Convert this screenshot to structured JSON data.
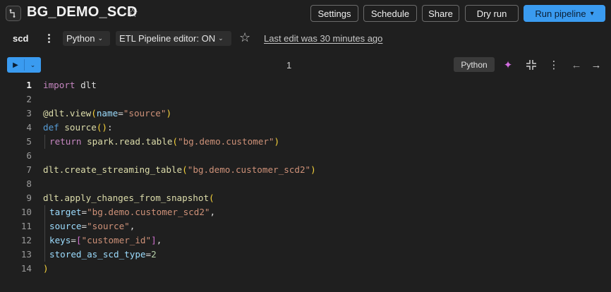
{
  "header": {
    "title": "BG_DEMO_SCD",
    "buttons": {
      "settings": "Settings",
      "schedule": "Schedule",
      "share": "Share",
      "dry_run": "Dry run",
      "run_pipeline": "Run pipeline"
    }
  },
  "toolbar": {
    "notebook_name": "scd",
    "language": "Python",
    "editor_mode": "ETL Pipeline editor: ON",
    "last_edit": "Last edit was 30 minutes ago"
  },
  "cell": {
    "number": "1",
    "language_badge": "Python"
  },
  "code": {
    "active_line": 1,
    "lines": [
      {
        "n": "1"
      },
      {
        "n": "2"
      },
      {
        "n": "3"
      },
      {
        "n": "4"
      },
      {
        "n": "5"
      },
      {
        "n": "6"
      },
      {
        "n": "7"
      },
      {
        "n": "8"
      },
      {
        "n": "9"
      },
      {
        "n": "10"
      },
      {
        "n": "11"
      },
      {
        "n": "12"
      },
      {
        "n": "13"
      },
      {
        "n": "14"
      }
    ],
    "tokens": {
      "l1_import": "import",
      "l1_mod": " dlt",
      "l3_deco": "@dlt.view",
      "l3_open": "(",
      "l3_arg": "name",
      "l3_eq": "=",
      "l3_str": "\"source\"",
      "l3_close": ")",
      "l4_def": "def",
      "l4_name": " source",
      "l4_parens": "()",
      "l4_colon": ":",
      "l5_return": "return",
      "l5_call": " spark.read.table",
      "l5_open": "(",
      "l5_str": "\"bg.demo.customer\"",
      "l5_close": ")",
      "l7_call": "dlt.create_streaming_table",
      "l7_open": "(",
      "l7_str": "\"bg.demo.customer_scd2\"",
      "l7_close": ")",
      "l9_call": "dlt.apply_changes_from_snapshot",
      "l9_open": "(",
      "l10_arg": "target",
      "l10_eq": "=",
      "l10_str": "\"bg.demo.customer_scd2\"",
      "l10_comma": ",",
      "l11_arg": "source",
      "l11_eq": "=",
      "l11_str": "\"source\"",
      "l11_comma": ",",
      "l12_arg": "keys",
      "l12_eq": "=",
      "l12_bopen": "[",
      "l12_str": "\"customer_id\"",
      "l12_bclose": "]",
      "l12_comma": ",",
      "l13_arg": "stored_as_scd_type",
      "l13_eq": "=",
      "l13_num": "2",
      "l14_close": ")"
    }
  },
  "icons": {
    "pipeline": "pipeline-icon",
    "favorite": "star-icon",
    "more": "kebab-icon",
    "run": "play-icon",
    "assistant": "sparkle-icon",
    "collapse": "collapse-icon",
    "prev": "arrow-left-icon",
    "next": "arrow-right-icon"
  },
  "colors": {
    "accent": "#3a9bf0",
    "background": "#1f1f1f",
    "assistant": "#d36de0"
  }
}
